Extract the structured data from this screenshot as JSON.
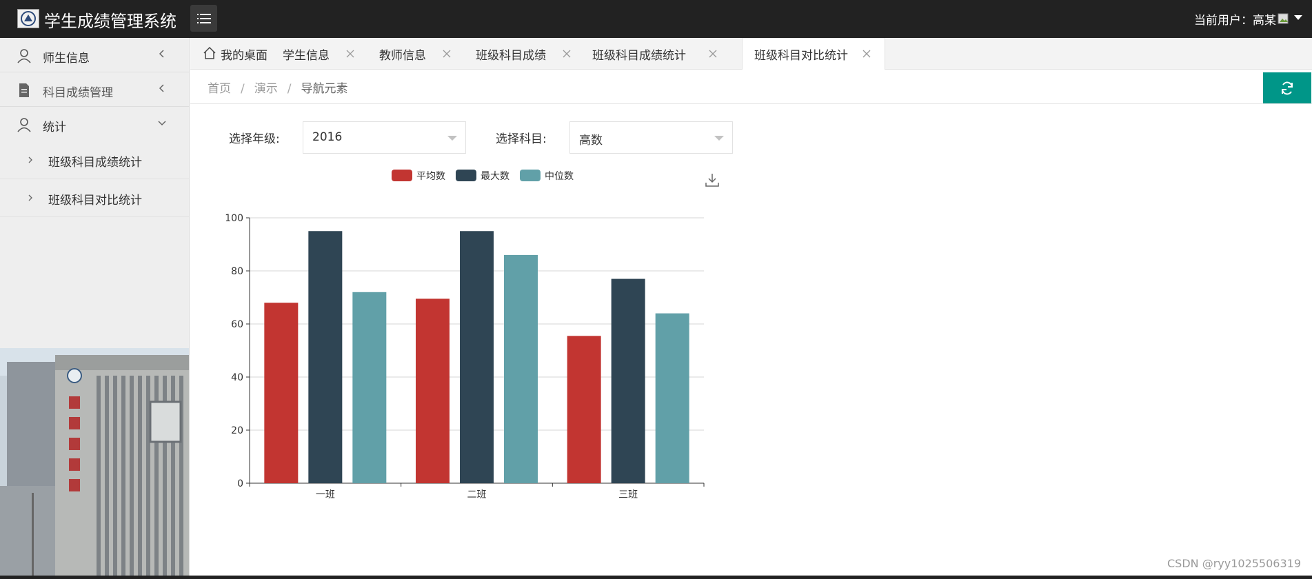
{
  "header": {
    "title": "学生成绩管理系统",
    "user_label": "当前用户：高某"
  },
  "sidebar": {
    "items": [
      {
        "label": "师生信息",
        "icon": "user-icon",
        "expanded": false
      },
      {
        "label": "科目成绩管理",
        "icon": "document-icon",
        "expanded": false
      },
      {
        "label": "统计",
        "icon": "user-icon",
        "expanded": true
      }
    ],
    "sub_items": [
      {
        "label": "班级科目成绩统计"
      },
      {
        "label": "班级科目对比统计"
      }
    ]
  },
  "tabs": [
    {
      "label": "我的桌面",
      "closable": false,
      "active": false
    },
    {
      "label": "学生信息",
      "closable": true,
      "active": false
    },
    {
      "label": "教师信息",
      "closable": true,
      "active": false
    },
    {
      "label": "班级科目成绩",
      "closable": true,
      "active": false
    },
    {
      "label": "班级科目成绩统计",
      "closable": true,
      "active": false
    },
    {
      "label": "班级科目对比统计",
      "closable": true,
      "active": true
    }
  ],
  "breadcrumb": {
    "items": [
      "首页",
      "演示"
    ],
    "current": "导航元素",
    "separator": "/"
  },
  "filters": {
    "grade": {
      "label": "选择年级:",
      "value": "2016"
    },
    "subject": {
      "label": "选择科目:",
      "value": "高数"
    }
  },
  "colors": {
    "header_bg": "#222222",
    "accent": "#009688",
    "series_avg": "#c23531",
    "series_max": "#2f4554",
    "series_median": "#61a0a8"
  },
  "chart_data": {
    "type": "bar",
    "categories": [
      "一班",
      "二班",
      "三班"
    ],
    "series": [
      {
        "name": "平均数",
        "color": "#c23531",
        "values": [
          68,
          69.5,
          55.5
        ]
      },
      {
        "name": "最大数",
        "color": "#2f4554",
        "values": [
          95,
          95,
          77
        ]
      },
      {
        "name": "中位数",
        "color": "#61a0a8",
        "values": [
          72,
          86,
          64
        ]
      }
    ],
    "ylim": [
      0,
      100
    ],
    "yticks": [
      0,
      20,
      40,
      60,
      80,
      100
    ],
    "legend_position": "top-center",
    "grid": true
  },
  "watermark": "CSDN @ryy1025506319"
}
